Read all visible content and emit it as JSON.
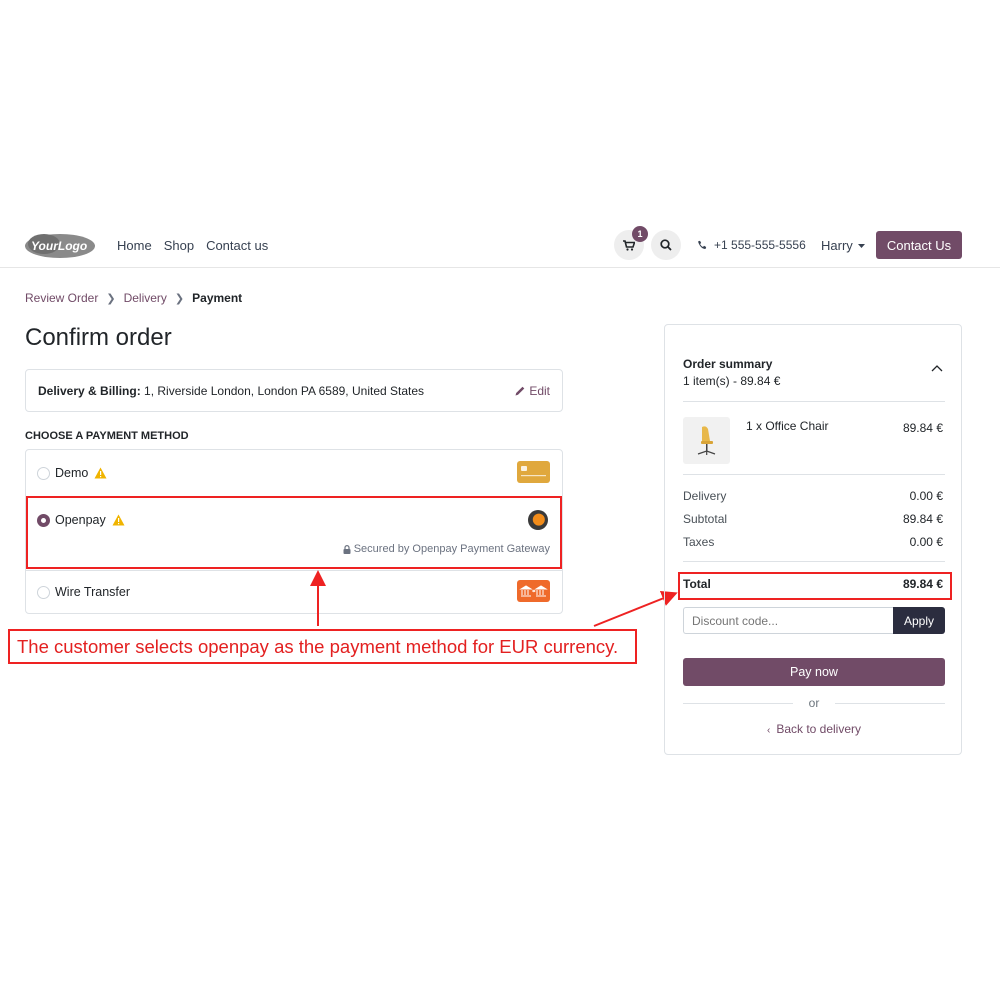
{
  "header": {
    "logo_text": "YourLogo",
    "nav": [
      "Home",
      "Shop",
      "Contact us"
    ],
    "cart_count": "1",
    "phone": "+1 555-555-5556",
    "user": "Harry",
    "contact_button": "Contact Us"
  },
  "breadcrumb": {
    "items": [
      "Review Order",
      "Delivery"
    ],
    "current": "Payment"
  },
  "page_title": "Confirm order",
  "address": {
    "label": "Delivery & Billing:",
    "value": "1, Riverside London, London PA 6589, United States",
    "edit": "Edit"
  },
  "payment": {
    "heading": "CHOOSE A PAYMENT METHOD",
    "methods": [
      {
        "label": "Demo",
        "selected": false,
        "icon": "card-icon"
      },
      {
        "label": "Openpay",
        "selected": true,
        "icon": "openpay-icon",
        "secured": "Secured by Openpay Payment Gateway"
      },
      {
        "label": "Wire Transfer",
        "selected": false,
        "icon": "bank-transfer-icon"
      }
    ]
  },
  "annotation": "The customer selects openpay as the payment method for EUR currency.",
  "summary": {
    "title": "Order summary",
    "subtitle": "1 item(s) -  89.84 €",
    "product_name": "1 x Office Chair",
    "product_price": "89.84 €",
    "rows": [
      {
        "label": "Delivery",
        "value": "0.00 €"
      },
      {
        "label": "Subtotal",
        "value": "89.84 €"
      },
      {
        "label": "Taxes",
        "value": "0.00 €"
      }
    ],
    "total_label": "Total",
    "total_value": "89.84 €",
    "discount_placeholder": "Discount code...",
    "apply": "Apply",
    "pay_now": "Pay now",
    "or": "or",
    "back": "Back to delivery"
  },
  "colors": {
    "brand": "#714b67",
    "annotation_red": "#ee2222",
    "warning": "#f0b400"
  }
}
